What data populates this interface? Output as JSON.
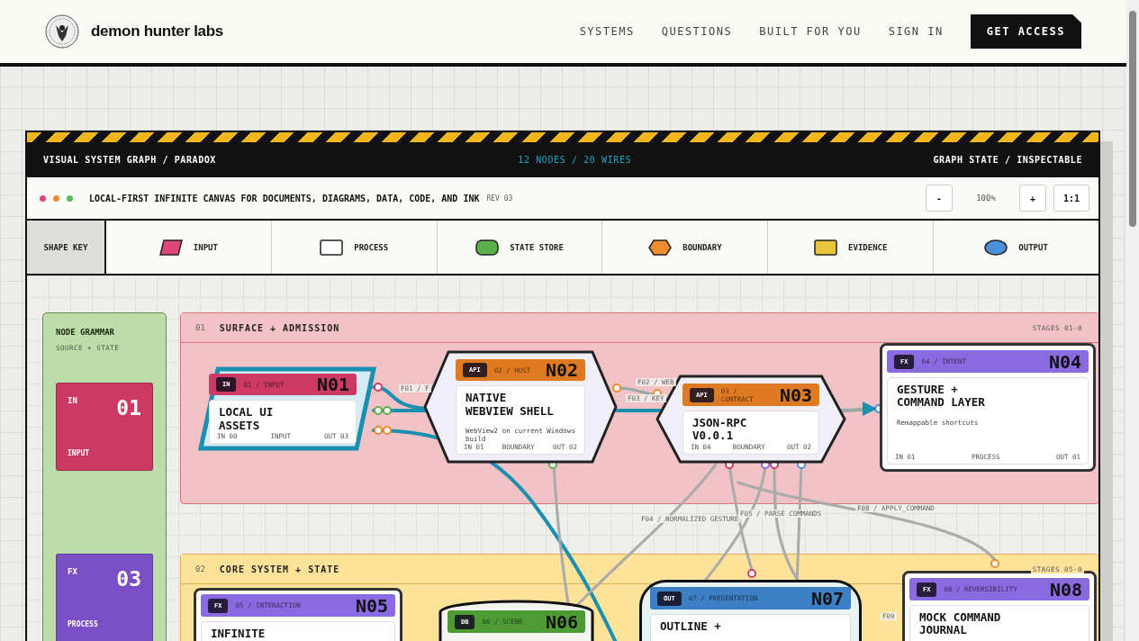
{
  "header": {
    "brand": "demon hunter labs",
    "nav": [
      {
        "label": "SYSTEMS"
      },
      {
        "label": "QUESTIONS"
      },
      {
        "label": "BUILT FOR YOU"
      },
      {
        "label": "SIGN IN"
      }
    ],
    "cta": "GET ACCESS"
  },
  "graph_bar": {
    "left": "VISUAL SYSTEM GRAPH / PARADOX",
    "center": "12 NODES / 20 WIRES",
    "right": "GRAPH STATE / INSPECTABLE"
  },
  "toolbar": {
    "dots": [
      {
        "color": "#e0457b"
      },
      {
        "color": "#f08c30"
      },
      {
        "color": "#5cb85c"
      }
    ],
    "title": "LOCAL-FIRST INFINITE CANVAS FOR DOCUMENTS, DIAGRAMS, DATA, CODE, AND INK",
    "rev": "REV 03",
    "zoom_out": "-",
    "zoom": "100%",
    "zoom_in": "+",
    "reset": "1:1"
  },
  "shape_key": {
    "label": "SHAPE KEY",
    "items": [
      {
        "label": "INPUT",
        "kind": "parallelogram",
        "color": "#e0457b"
      },
      {
        "label": "PROCESS",
        "kind": "rect",
        "color": "#ffffff"
      },
      {
        "label": "STATE STORE",
        "kind": "pill",
        "color": "#5cb04a"
      },
      {
        "label": "BOUNDARY",
        "kind": "hexagon",
        "color": "#f08c30"
      },
      {
        "label": "EVIDENCE",
        "kind": "rect",
        "color": "#e8c53a"
      },
      {
        "label": "OUTPUT",
        "kind": "ellipse",
        "color": "#4a90d9"
      }
    ]
  },
  "grammar": {
    "title": "NODE GRAMMAR",
    "subtitle": "SOURCE + STATE",
    "cards": [
      {
        "tag": "IN",
        "number": "01",
        "label": "INPUT",
        "color": "#cc3a64"
      },
      {
        "tag": "FX",
        "number": "03",
        "label": "PROCESS",
        "color": "#7b4fc4"
      }
    ]
  },
  "groups": [
    {
      "index": "01",
      "title": "SURFACE + ADMISSION",
      "stages": "STAGES 01-0",
      "color": "#f1c3c6"
    },
    {
      "index": "02",
      "title": "CORE SYSTEM + STATE",
      "stages": "STAGES 05-0",
      "color": "#fde29a"
    }
  ],
  "nodes": [
    {
      "id": "N01",
      "tag": "IN",
      "ref": "01 / INPUT",
      "title": "LOCAL UI\nASSETS",
      "kind": "parallelogram",
      "color": "#cc3a64",
      "footer": [
        "IN 00",
        "INPUT",
        "OUT 03"
      ]
    },
    {
      "id": "N02",
      "tag": "API",
      "ref": "02 / HOST",
      "title": "NATIVE\nWEBVIEW SHELL",
      "desc": "WebView2 on current Windows build",
      "kind": "hexagon",
      "color": "#e07a22",
      "footer": [
        "IN 01",
        "BOUNDARY",
        "OUT 02"
      ]
    },
    {
      "id": "N03",
      "tag": "API",
      "ref": "03 / CONTRACT",
      "title": "JSON-RPC\nV0.0.1",
      "kind": "hexagon",
      "color": "#e07a22",
      "footer": [
        "IN 04",
        "BOUNDARY",
        "OUT 02"
      ]
    },
    {
      "id": "N04",
      "tag": "FX",
      "ref": "04 / INTENT",
      "title": "GESTURE +\nCOMMAND LAYER",
      "desc": "Remappable shortcuts",
      "kind": "rect",
      "color": "#8a6ae0",
      "footer": [
        "IN 01",
        "PROCESS",
        "OUT 01"
      ]
    },
    {
      "id": "N05",
      "tag": "FX",
      "ref": "05 / INTERACTION",
      "title": "INFINITE",
      "kind": "rect",
      "color": "#8a6ae0"
    },
    {
      "id": "N06",
      "tag": "DB",
      "ref": "06 / SCENE",
      "kind": "cylinder",
      "color": "#4e9a34"
    },
    {
      "id": "N07",
      "tag": "OUT",
      "ref": "07 / PRESENTATION",
      "title": "OUTLINE +",
      "kind": "rounded",
      "color": "#3d7fc4"
    },
    {
      "id": "N08",
      "tag": "FX",
      "ref": "08 / REVERSIBILITY",
      "title": "MOCK COMMAND\nJOURNAL",
      "kind": "rect",
      "color": "#8a6ae0"
    }
  ],
  "wire_labels": [
    "F01 / F",
    "F02 / WEB",
    "F03 / KEY",
    "F04 / NORMALIZED GESTURE",
    "F05 / PARSE COMMANDS",
    "F08 / APPLY_COMMAND",
    "F09"
  ]
}
